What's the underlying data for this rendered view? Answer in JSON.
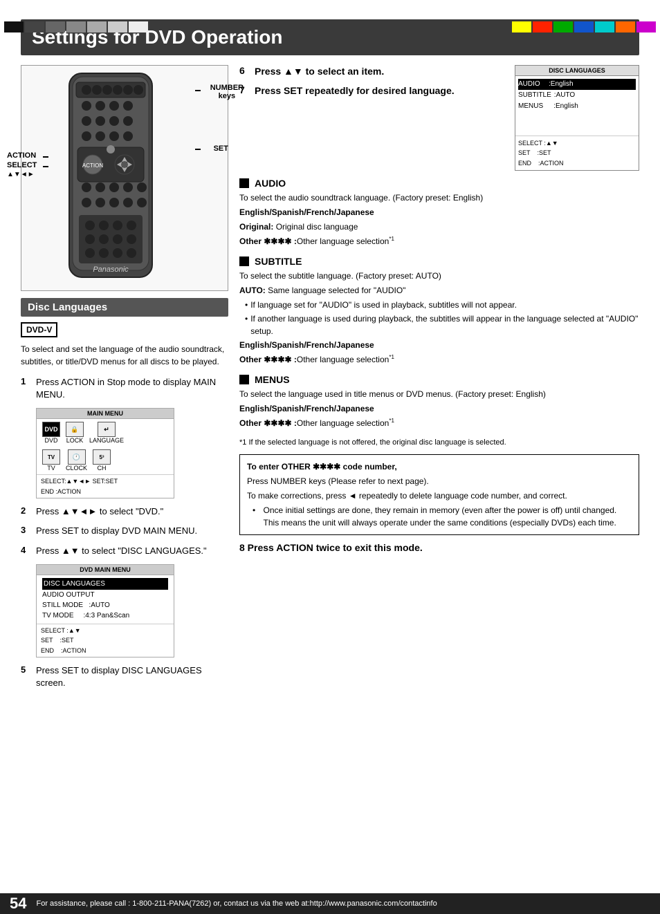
{
  "page": {
    "title": "Settings for DVD Operation",
    "section": "Disc Languages",
    "dvd_badge": "DVD-V",
    "footer_number": "54",
    "footer_text": "For assistance, please call : 1-800-211-PANA(7262) or, contact us via the web at:http://www.panasonic.com/contactinfo"
  },
  "intro": "To select and set the language of the audio soundtrack, subtitles, or title/DVD menus for all discs to be played.",
  "left_steps": [
    {
      "num": "1",
      "text": "Press ACTION in Stop mode to display MAIN MENU."
    },
    {
      "num": "2",
      "text": "Press ▲▼◄► to select \"DVD.\""
    },
    {
      "num": "3",
      "text": "Press SET to display DVD MAIN MENU."
    },
    {
      "num": "4",
      "text": "Press ▲▼ to select \"DISC LANGUAGES.\""
    },
    {
      "num": "5",
      "text": "Press SET to display DISC LANGUAGES screen."
    }
  ],
  "right_steps": [
    {
      "num": "6",
      "text": "Press ▲▼ to select an item."
    },
    {
      "num": "7",
      "text": "Press SET repeatedly for desired language."
    }
  ],
  "step8": "8  Press ACTION twice to exit this mode.",
  "remote_labels": {
    "action": "ACTION",
    "select": "SELECT",
    "arrows": "▲▼◄►",
    "number": "NUMBER\nkeys",
    "set": "SET"
  },
  "main_menu": {
    "title": "MAIN MENU",
    "icons": [
      {
        "label": "DVD",
        "icon": "DVD"
      },
      {
        "label": "LOCK",
        "icon": "🔒"
      },
      {
        "label": "LANGUAGE",
        "icon": "→"
      }
    ],
    "icons2": [
      {
        "label": "TV",
        "icon": "TV"
      },
      {
        "label": "CLOCK",
        "icon": "🕐"
      },
      {
        "label": "CH",
        "icon": "53"
      }
    ],
    "bottom": "SELECT:▲▼◄►  SET:SET\nEND   :ACTION"
  },
  "dvd_main_menu": {
    "title": "DVD MAIN MENU",
    "items": [
      "DISC LANGUAGES",
      "AUDIO OUTPUT",
      "STILL MODE    :AUTO",
      "TV MODE       :4:3 Pan&Scan"
    ],
    "bottom": "SELECT :▲▼\nSET    :SET\nEND    :ACTION"
  },
  "disc_languages": {
    "title": "DISC LANGUAGES",
    "rows": [
      {
        "label": "AUDIO",
        "value": ":English",
        "highlighted": true
      },
      {
        "label": "SUBTITLE",
        "value": ":AUTO",
        "highlighted": false
      },
      {
        "label": "MENUS",
        "value": ":English",
        "highlighted": false
      }
    ],
    "bottom": "SELECT :▲▼\nSET    :SET\nEND    :ACTION"
  },
  "sections": {
    "audio": {
      "title": "AUDIO",
      "body": "To select the audio soundtrack language. (Factory preset: English)",
      "bold1": "English/Spanish/French/Japanese",
      "original": "Original:",
      "original_desc": "Original disc language",
      "other": "Other ✱✱✱✱ :",
      "other_desc": "Other language selection"
    },
    "subtitle": {
      "title": "SUBTITLE",
      "body": "To select the subtitle language. (Factory preset: AUTO)",
      "bold1": "AUTO:",
      "bold1_desc": "Same language selected for \"AUDIO\"",
      "bullets": [
        "If language set for \"AUDIO\" is used in playback, subtitles will not appear.",
        "If another language is used during playback, the subtitles will appear in the language selected at \"AUDIO\" setup."
      ],
      "bold2": "English/Spanish/French/Japanese",
      "other": "Other ✱✱✱✱ :",
      "other_desc": "Other language selection"
    },
    "menus": {
      "title": "MENUS",
      "body": "To select the language used in title menus or DVD menus. (Factory preset: English)",
      "bold1": "English/Spanish/French/Japanese",
      "other": "Other ✱✱✱✱ :",
      "other_desc": "Other language selection"
    }
  },
  "footnote": "*1 If the selected language is not offered, the original disc language is selected.",
  "info_box": {
    "line1": "To enter OTHER ✱✱✱✱ code number,",
    "line2": "Press NUMBER keys (Please refer to next page).",
    "line3": "To make corrections, press ◄ repeatedly to delete language code number, and correct.",
    "bullet": "Once initial settings are done, they remain in memory (even after the power is off) until changed. This means the unit will always operate under the same conditions (especially DVDs) each time."
  },
  "colors": {
    "title_bg": "#3a3a3a",
    "section_heading_bg": "#555555",
    "footer_bg": "#222222",
    "accent": "#000000"
  },
  "color_bars_left": [
    "#000",
    "#333",
    "#555",
    "#777",
    "#999",
    "#bbb",
    "#ddd"
  ],
  "color_bars_right": [
    "#ffff00",
    "#ff0000",
    "#00aa00",
    "#0000ff",
    "#00cccc",
    "#ff6600",
    "#cc00cc"
  ]
}
